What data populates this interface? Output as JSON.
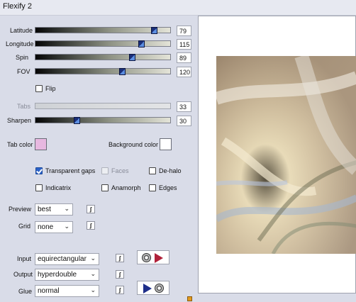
{
  "window": {
    "title": "Flexify 2"
  },
  "sliders": [
    {
      "label": "Latitude",
      "value": "79",
      "level": 0.9,
      "enabled": true
    },
    {
      "label": "Longitude",
      "value": "115",
      "level": 0.8,
      "enabled": true
    },
    {
      "label": "Spin",
      "value": "89",
      "level": 0.73,
      "enabled": true
    },
    {
      "label": "FOV",
      "value": "120",
      "level": 0.65,
      "enabled": true
    }
  ],
  "flip": {
    "label": "Flip",
    "checked": false
  },
  "tabs": {
    "label": "Tabs",
    "value": "33",
    "enabled": false
  },
  "sharpen": {
    "label": "Sharpen",
    "value": "30",
    "level": 0.3
  },
  "tab_color": {
    "label": "Tab color",
    "color": "#e7b8e0"
  },
  "background_color": {
    "label": "Background color",
    "color": "#ffffff"
  },
  "options": {
    "transparent_gaps": {
      "label": "Transparent gaps",
      "checked": true
    },
    "faces": {
      "label": "Faces",
      "checked": false,
      "enabled": false
    },
    "de_halo": {
      "label": "De-halo",
      "checked": false
    },
    "indicatrix": {
      "label": "Indicatrix",
      "checked": false
    },
    "anamorph": {
      "label": "Anamorph",
      "checked": false
    },
    "edges": {
      "label": "Edges",
      "checked": false
    }
  },
  "preview": {
    "label": "Preview",
    "value": "best"
  },
  "grid": {
    "label": "Grid",
    "value": "none"
  },
  "input": {
    "label": "Input",
    "value": "equirectangular"
  },
  "output": {
    "label": "Output",
    "value": "hyperdouble"
  },
  "glue": {
    "label": "Glue",
    "value": "normal"
  },
  "link_glyph": "ʃ",
  "icons": {
    "chevron": "chevron-down-icon",
    "link": "link-icon",
    "disc": "disc-icon",
    "play": "play-arrow-icon"
  }
}
